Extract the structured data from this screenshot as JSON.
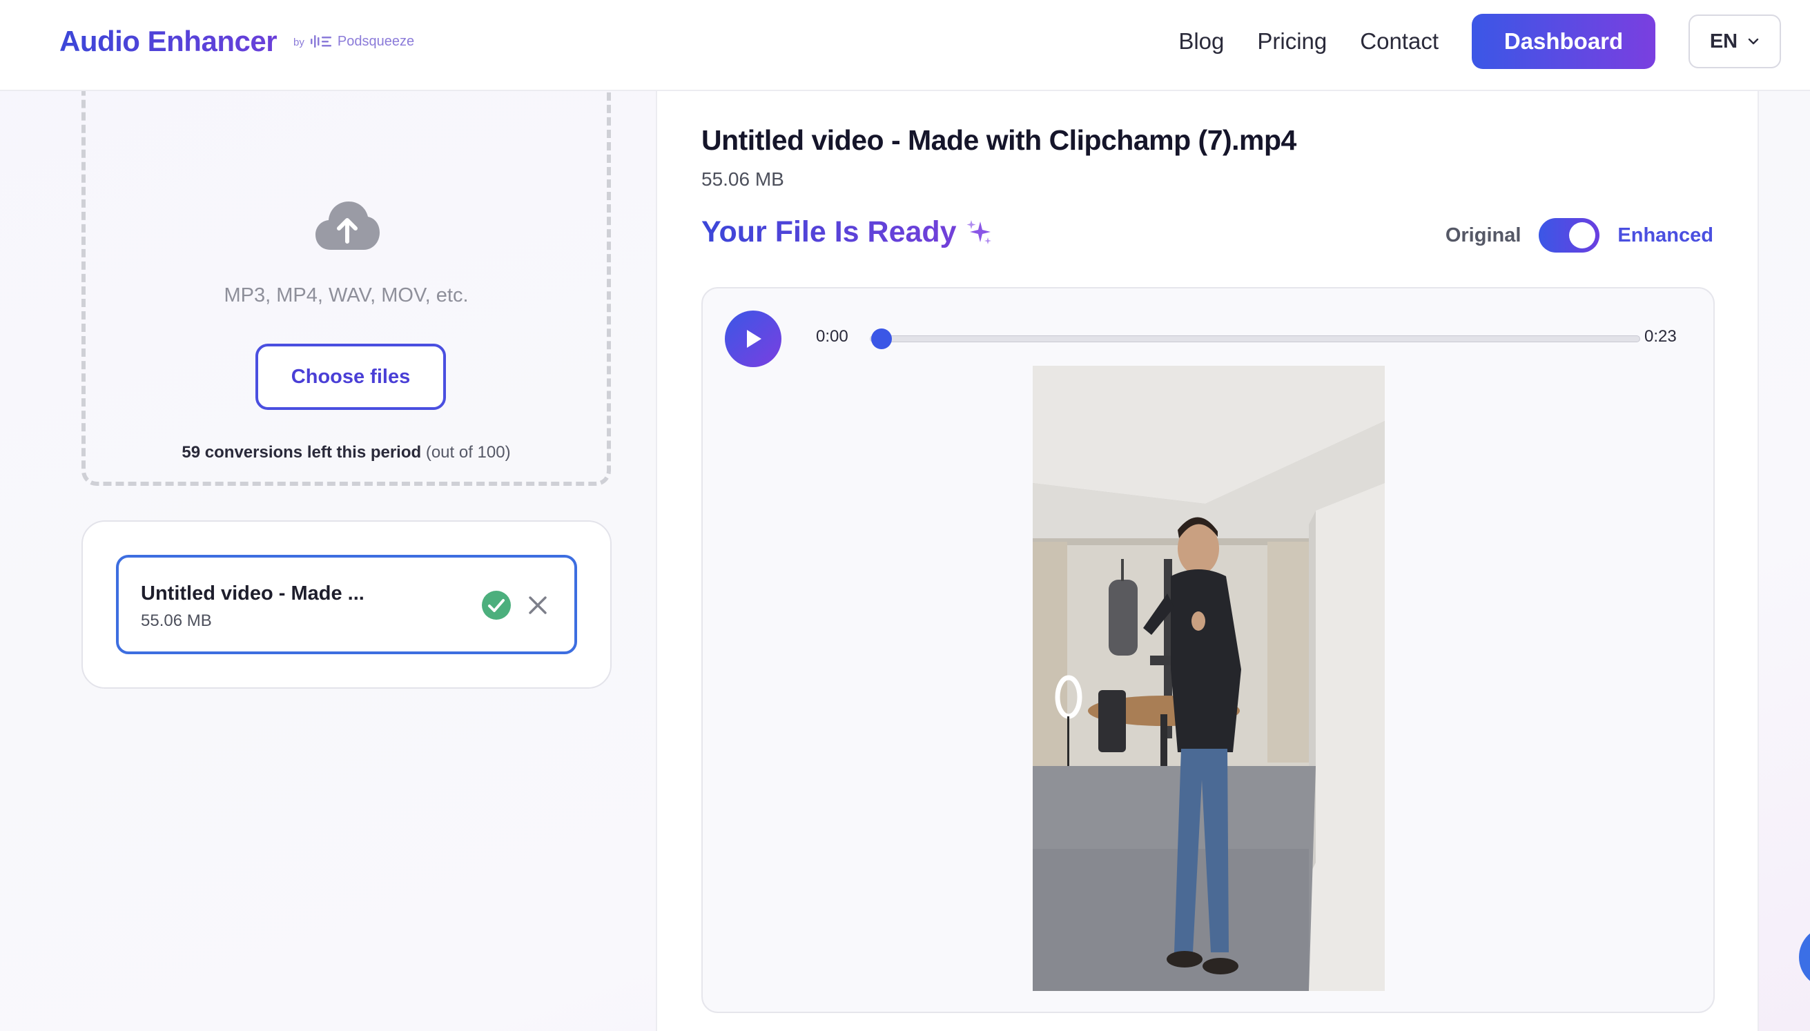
{
  "header": {
    "brand_title": "Audio Enhancer",
    "brand_by": "by",
    "brand_partner": "Podsqueeze",
    "nav": [
      "Blog",
      "Pricing",
      "Contact"
    ],
    "dashboard_label": "Dashboard",
    "language": "EN"
  },
  "upload": {
    "formats": "MP3, MP4, WAV, MOV, etc.",
    "choose_label": "Choose files",
    "conversions_bold": "59 conversions left this period",
    "conversions_total": "(out of 100)"
  },
  "file_list": {
    "items": [
      {
        "name": "Untitled video - Made ...",
        "size": "55.06 MB",
        "status": "done"
      }
    ]
  },
  "result": {
    "file_title": "Untitled video - Made with Clipchamp (7).mp4",
    "file_size": "55.06 MB",
    "ready_title": "Your File Is Ready",
    "toggle_original": "Original",
    "toggle_enhanced": "Enhanced",
    "toggle_state": "enhanced"
  },
  "player": {
    "current_time": "0:00",
    "duration": "0:23",
    "progress": 0
  },
  "colors": {
    "accent_start": "#3b57e6",
    "accent_end": "#7a3fe0",
    "success": "#4caf7d",
    "border_active": "#3d6ee0"
  },
  "icons": {
    "upload": "cloud-upload-icon",
    "check": "check-circle-icon",
    "remove": "close-icon",
    "play": "play-icon",
    "sparkle": "sparkle-icon",
    "chevron": "chevron-down-icon",
    "partner_logo": "waveform-icon"
  }
}
